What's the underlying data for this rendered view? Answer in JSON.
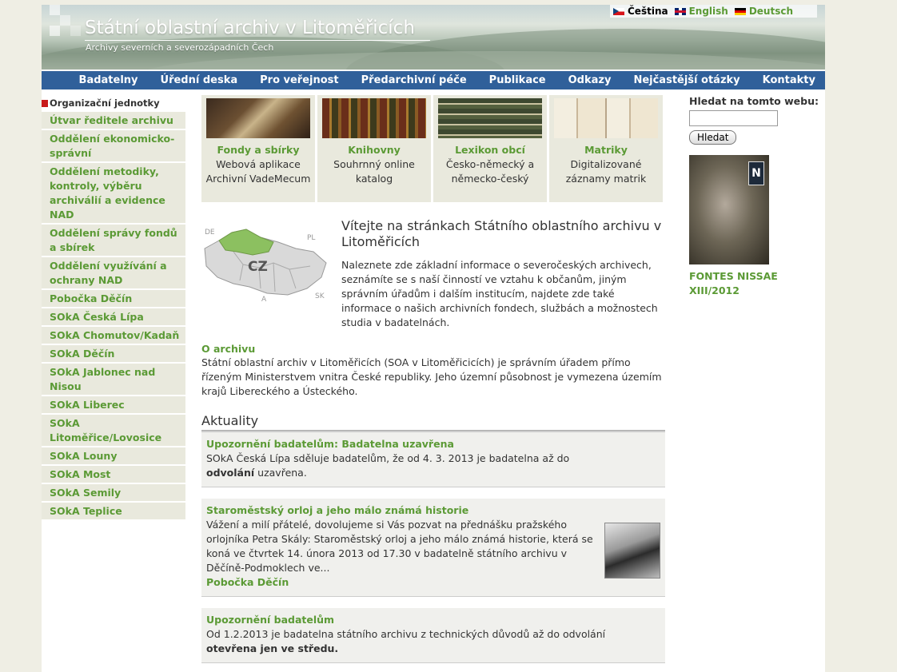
{
  "header": {
    "title": "Státní oblastní archiv v Litoměřicích",
    "subtitle": "Archivy severních a severozápadních Čech",
    "languages": [
      {
        "label": "Čeština",
        "flag": "flag-cz-icon"
      },
      {
        "label": "English",
        "flag": "flag-uk-icon"
      },
      {
        "label": "Deutsch",
        "flag": "flag-de-icon"
      }
    ]
  },
  "nav": [
    "Badatelny",
    "Úřední deska",
    "Pro veřejnost",
    "Předarchivní péče",
    "Publikace",
    "Odkazy",
    "Nejčastější otázky",
    "Kontakty"
  ],
  "sidebar": {
    "heading": "Organizační jednotky",
    "items": [
      "Útvar ředitele archivu",
      "Oddělení ekonomicko-správní",
      "Oddělení metodiky, kontroly, výběru archiválií a evidence NAD",
      "Oddělení správy fondů a sbírek",
      "Oddělení využívání a ochrany NAD",
      "Pobočka Děčín",
      "SOkA Česká Lípa",
      "SOkA Chomutov/Kadaň",
      "SOkA Děčín",
      "SOkA Jablonec nad Nisou",
      "SOkA Liberec",
      "SOkA Litoměřice/Lovosice",
      "SOkA Louny",
      "SOkA Most",
      "SOkA Semily",
      "SOkA Teplice"
    ]
  },
  "tiles": [
    {
      "title": "Fondy a sbírky",
      "desc": "Webová aplikace Archivní VadeMecum"
    },
    {
      "title": "Knihovny",
      "desc": "Souhrnný online katalog"
    },
    {
      "title": "Lexikon obcí",
      "desc": "Česko-německý a německo-český"
    },
    {
      "title": "Matriky",
      "desc": "Digitalizované záznamy matrik"
    }
  ],
  "map": {
    "labels": {
      "de": "DE",
      "pl": "PL",
      "cz": "CZ",
      "a": "A",
      "sk": "SK"
    }
  },
  "welcome": {
    "title": "Vítejte na stránkach Státního oblastního archivu v Litoměřicích",
    "text": "Naleznete zde základní informace o severočeských archivech, seznámíte se s naší činností ve vztahu k občanům, jiným správním úřadům i dalším institucím, najdete zde také informace o našich archivních fondech, službách a možnostech studia v badatelnách."
  },
  "about": {
    "title": "O archivu",
    "text": "Státní oblastní archiv v Litoměřicích (SOA v Litoměřicicích) je správním úřadem přímo řízeným Ministerstvem vnitra České republiky. Jeho územní působnost je vymezena územím krajů Libereckého a Ústeckého."
  },
  "news": {
    "heading": "Aktuality",
    "items": [
      {
        "title": "Upozornění badatelům: Badatelna uzavřena",
        "text": "SOkA Česká Lípa sděluje badatelům, že od 4. 3. 2013 je badatelna až do",
        "bold": "odvolání",
        "tail": " uzavřena."
      },
      {
        "title": "Staroměstský orloj a jeho málo známá historie",
        "text": "Vážení a milí přátelé, dovolujeme si Vás pozvat na přednášku pražského orlojníka Petra Skály: Staroměstský orloj a jeho málo známá historie, která se koná ve čtvrtek 14. února 2013 od 17.30 v badatelně státního archivu v Děčíně-Podmoklech ve...",
        "source": "Pobočka Děčín"
      },
      {
        "title": "Upozornění badatelům",
        "text": "Od 1.2.2013 je badatelna státního archivu z technických důvodů až do odvolání",
        "bold": "otevřena jen ve středu."
      }
    ]
  },
  "right": {
    "search_label": "Hledat na tomto webu:",
    "search_value": "",
    "search_button": "Hledat",
    "book_title": "FONTES NISSAE XIII/2012"
  },
  "colors": {
    "nav": "#30609a",
    "link": "#5b9a35",
    "sidebar_bg": "#e9e9dd"
  }
}
